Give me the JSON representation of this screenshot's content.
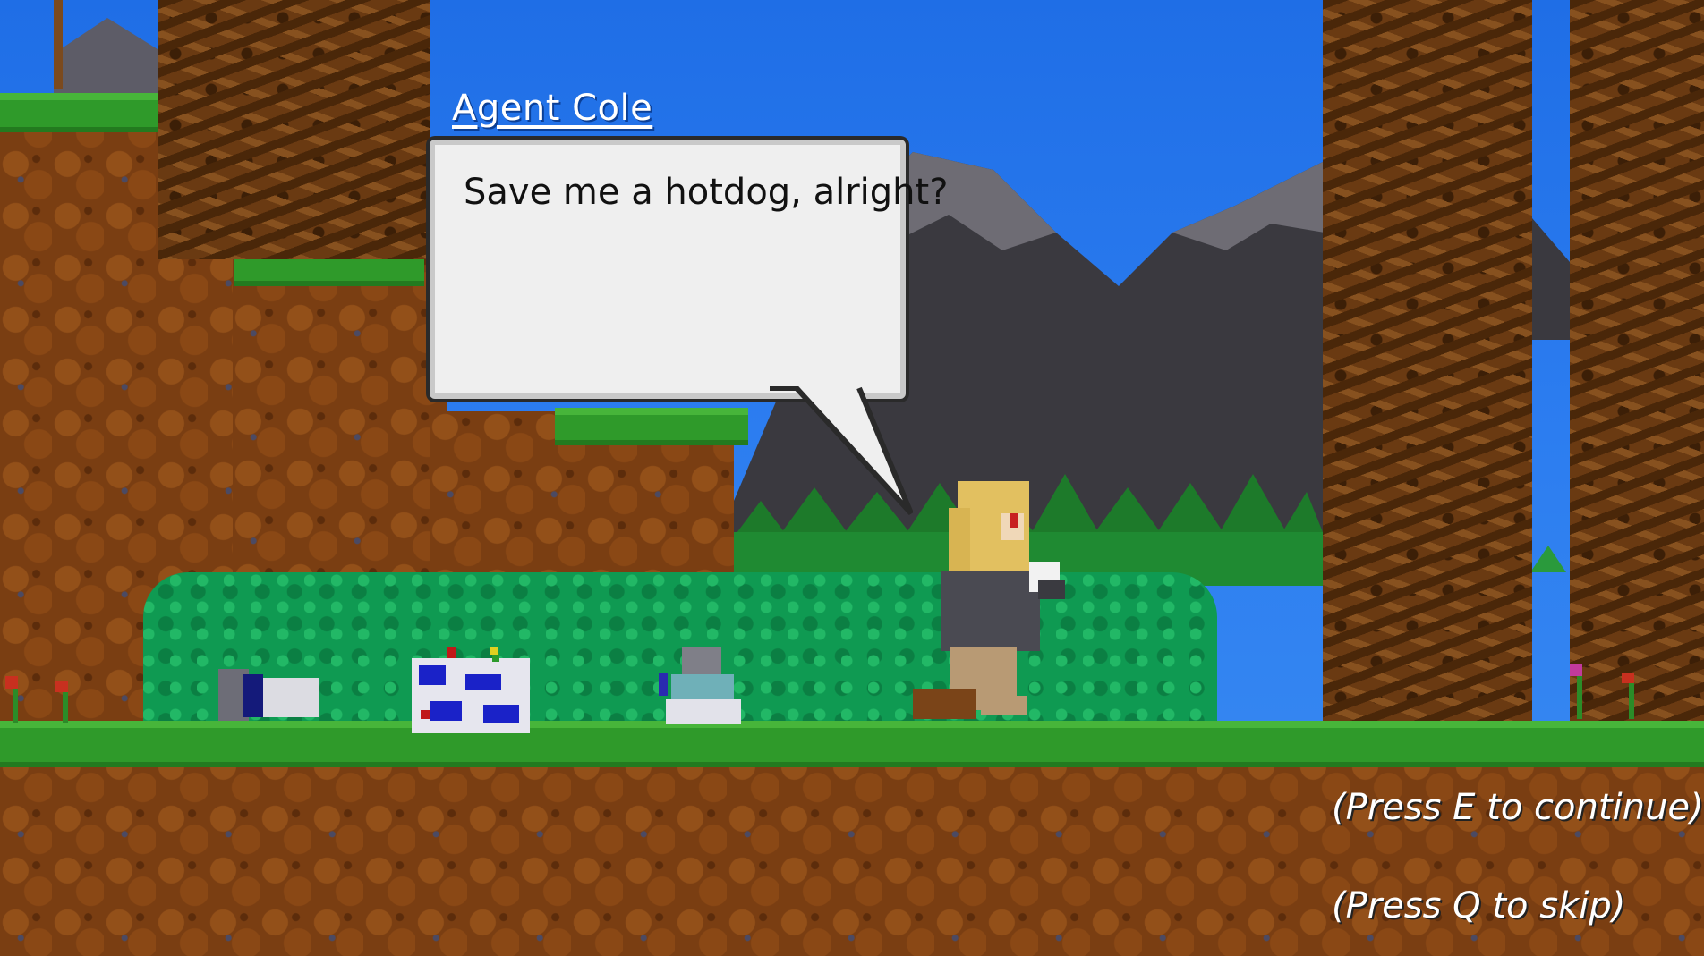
{
  "dialogue": {
    "speaker": "Agent Cole",
    "text": "Save me a hotdog, alright?"
  },
  "prompts": {
    "continue": "(Press E to continue)",
    "skip": "(Press Q to skip)"
  },
  "colors": {
    "sky": "#1f6ee6",
    "grass": "#2f9a2a",
    "dirt": "#7a3e12",
    "bush": "#0f9a52",
    "bubble": "#efefef"
  }
}
